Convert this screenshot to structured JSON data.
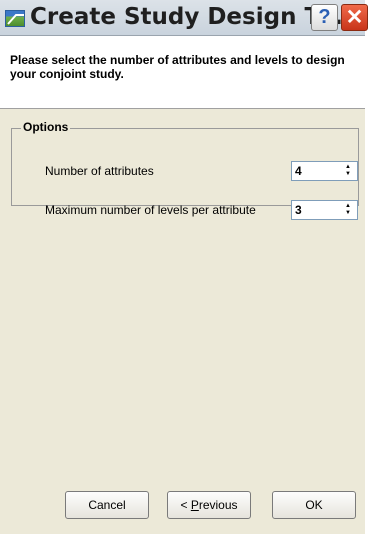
{
  "window": {
    "title": "Create Study Design T...",
    "help_label": "?",
    "close_label": "✕"
  },
  "header": {
    "instruction": "Please select the number of attributes and levels to design your conjoint study."
  },
  "options": {
    "group_label": "Options",
    "attributes": {
      "label": "Number of attributes",
      "value": "4"
    },
    "levels": {
      "label": "Maximum number of levels per attribute",
      "value": "3"
    }
  },
  "buttons": {
    "cancel": "Cancel",
    "previous_prefix": "< ",
    "previous_mnemonic": "P",
    "previous_rest": "revious",
    "ok": "OK"
  }
}
